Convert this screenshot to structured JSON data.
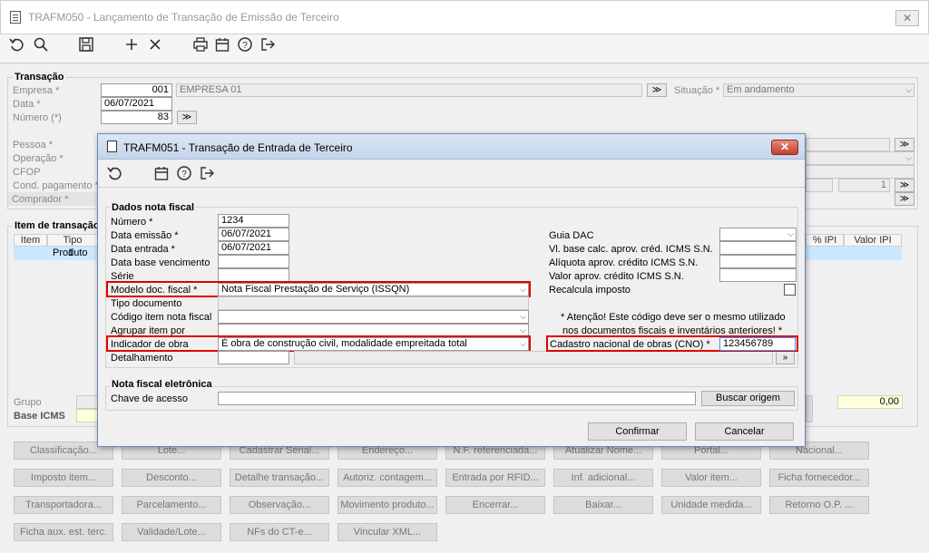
{
  "window": {
    "title": "TRAFM050 - Lançamento de Transação de Emissão de Terceiro",
    "close": "✕"
  },
  "toolbar_icons": [
    "undo-icon",
    "search-icon",
    "save-icon",
    "add-icon",
    "delete-icon",
    "print-icon",
    "calendar-icon",
    "help-icon",
    "exit-icon"
  ],
  "transacao": {
    "title": "Transação",
    "empresa_label": "Empresa *",
    "empresa_code": "001",
    "empresa_name": "EMPRESA 01",
    "data_label": "Data *",
    "data_value": "06/07/2021",
    "numero_label": "Número (*)",
    "numero_value": "83",
    "situacao_label": "Situação *",
    "situacao_value": "Em andamento",
    "pessoa_label": "Pessoa *",
    "operacao_label": "Operação *",
    "cfop_label": "CFOP",
    "cond_pagamento_label": "Cond. pagamento *",
    "comprador_label": "Comprador *",
    "cond_value": "1"
  },
  "item_grid": {
    "title": "Item de transação",
    "col_item": "Item",
    "col_tipo": "Tipo",
    "col_ipi": "% IPI",
    "col_valor_ipi": "Valor IPI",
    "row_item": "1",
    "row_tipo": "Produto"
  },
  "grupo_label": "Grupo",
  "base_icms_label": "Base ICMS",
  "base_value": "0,00",
  "bottom_buttons": [
    [
      "Classificação...",
      "Lote...",
      "Cadastrar Serial...",
      "Endereço...",
      "N.F. referenciada...",
      "Atualizar Nome...",
      "Portal...",
      "Nacional..."
    ],
    [
      "Imposto item...",
      "Desconto...",
      "Detalhe transação...",
      "Autoriz. contagem...",
      "Entrada por RFID...",
      "Inf. adicional...",
      "Valor item...",
      "Ficha fornecedor..."
    ],
    [
      "Transportadora...",
      "Parcelamento...",
      "Observação...",
      "Movimento produto...",
      "Encerrar...",
      "Baixar...",
      "Unidade medida...",
      "Retorno O.P. ..."
    ],
    [
      "Ficha aux. est. terc.",
      "Validade/Lote...",
      "NFs do CT-e...",
      "Vincular XML..."
    ]
  ],
  "dialog": {
    "title": "TRAFM051 - Transação de Entrada de Terceiro",
    "close": "✕",
    "toolbar_icons": [
      "undo-icon",
      "calendar-icon",
      "help-icon",
      "exit-icon"
    ],
    "dados_title": "Dados nota fiscal",
    "numero_label": "Número *",
    "numero_value": "1234",
    "emissao_label": "Data emissão *",
    "emissao_value": "06/07/2021",
    "entrada_label": "Data entrada *",
    "entrada_value": "06/07/2021",
    "base_venc_label": "Data base vencimento",
    "base_venc_value": "",
    "serie_label": "Série",
    "serie_value": "",
    "modelo_label": "Modelo doc. fiscal *",
    "modelo_value": "Nota Fiscal Prestação de Serviço (ISSQN)",
    "tipo_doc_label": "Tipo documento",
    "codigo_item_label": "Código item nota fiscal",
    "agrupar_label": "Agrupar item por",
    "indicador_label": "Indicador de obra",
    "indicador_value": "É obra de construção civil, modalidade empreitada total",
    "detalhamento_label": "Detalhamento",
    "guia_label": "Guia DAC",
    "vl_base_label": "Vl. base calc. aprov. créd. ICMS S.N.",
    "aliquota_label": "Alíquota aprov. crédito ICMS S.N.",
    "valor_aprov_label": "Valor aprov. crédito ICMS S.N.",
    "recalcula_label": "Recalcula imposto",
    "atencao_line1": "* Atenção! Este código deve ser o mesmo utilizado",
    "atencao_line2": "nos documentos fiscais e inventários anteriores! *",
    "cno_label": "Cadastro nacional de obras (CNO) *",
    "cno_value": "123456789",
    "detail_btn": "»",
    "nfe_title": "Nota fiscal eletrônica",
    "chave_label": "Chave de acesso",
    "chave_value": "",
    "buscar_label": "Buscar origem",
    "confirmar_label": "Confirmar",
    "cancelar_label": "Cancelar"
  }
}
